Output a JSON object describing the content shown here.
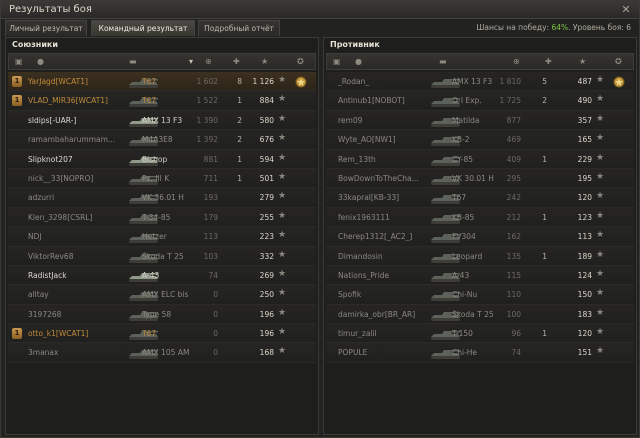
{
  "window": {
    "title": "Результаты боя",
    "close_icon": "close-icon"
  },
  "tabs": [
    {
      "label": "Личный результат",
      "active": false
    },
    {
      "label": "Командный результат",
      "active": true
    },
    {
      "label": "Подробный отчёт",
      "active": false
    }
  ],
  "summary": {
    "win_chance_label": "Шансы на победу:",
    "win_chance_value": "64%",
    "battle_level_label": "Уровень боя:",
    "battle_level_value": "6"
  },
  "allies": {
    "title": "Союзники",
    "rows": [
      {
        "player": "YarJagd[WCAT1]",
        "tank": "T67",
        "damage": "1 602",
        "kills": "8",
        "xp": "1 126",
        "platoon": "1",
        "self": true,
        "alive": false,
        "medal": true
      },
      {
        "player": "VLAD_MIR36[WCAT1]",
        "tank": "T67",
        "damage": "1 522",
        "kills": "1",
        "xp": "884",
        "platoon": "1",
        "self": false,
        "alive": false,
        "medal": false
      },
      {
        "player": "sldips[-UAR-]",
        "tank": "AMX 13 F3",
        "damage": "1 390",
        "kills": "2",
        "xp": "580",
        "platoon": "",
        "self": false,
        "alive": true,
        "medal": false
      },
      {
        "player": "ramambaharummam...",
        "tank": "M4A3E8",
        "damage": "1 392",
        "kills": "2",
        "xp": "676",
        "platoon": "",
        "self": false,
        "alive": false,
        "medal": false
      },
      {
        "player": "Slipknot207",
        "tank": "Bishop",
        "damage": "881",
        "kills": "1",
        "xp": "594",
        "platoon": "",
        "self": false,
        "alive": true,
        "medal": false
      },
      {
        "player": "nick__33[NOPRO]",
        "tank": "Pz. III K",
        "damage": "711",
        "kills": "1",
        "xp": "501",
        "platoon": "",
        "self": false,
        "alive": false,
        "medal": false
      },
      {
        "player": "adzurri",
        "tank": "VK 36.01 H",
        "damage": "193",
        "kills": "",
        "xp": "279",
        "platoon": "",
        "self": false,
        "alive": false,
        "medal": false
      },
      {
        "player": "Klen_3298[CSRL]",
        "tank": "T-34-85",
        "damage": "179",
        "kills": "",
        "xp": "255",
        "platoon": "",
        "self": false,
        "alive": false,
        "medal": false
      },
      {
        "player": "NDJ",
        "tank": "Hetzer",
        "damage": "113",
        "kills": "",
        "xp": "223",
        "platoon": "",
        "self": false,
        "alive": false,
        "medal": false
      },
      {
        "player": "ViktorRev68",
        "tank": "Škoda T 25",
        "damage": "103",
        "kills": "",
        "xp": "332",
        "platoon": "",
        "self": false,
        "alive": false,
        "medal": false
      },
      {
        "player": "RadistJack",
        "tank": "A-43",
        "damage": "74",
        "kills": "",
        "xp": "269",
        "platoon": "",
        "self": false,
        "alive": true,
        "medal": false
      },
      {
        "player": "alltay",
        "tank": "AMX ELC bis",
        "damage": "0",
        "kills": "",
        "xp": "250",
        "platoon": "",
        "self": false,
        "alive": false,
        "medal": false
      },
      {
        "player": "3197268",
        "tank": "Type 58",
        "damage": "0",
        "kills": "",
        "xp": "196",
        "platoon": "",
        "self": false,
        "alive": false,
        "medal": false
      },
      {
        "player": "otto_k1[WCAT1]",
        "tank": "T67",
        "damage": "0",
        "kills": "",
        "xp": "196",
        "platoon": "1",
        "self": false,
        "alive": false,
        "medal": false
      },
      {
        "player": "3manax",
        "tank": "AMX 105 AM",
        "damage": "0",
        "kills": "",
        "xp": "168",
        "platoon": "",
        "self": false,
        "alive": false,
        "medal": false
      }
    ]
  },
  "enemies": {
    "title": "Противник",
    "rows": [
      {
        "player": "_Rodan_",
        "tank": "AMX 13 F3",
        "damage": "1 810",
        "kills": "5",
        "xp": "487",
        "medal": true
      },
      {
        "player": "Antinub1[NOBOT]",
        "tank": "O-I Exp.",
        "damage": "1 725",
        "kills": "2",
        "xp": "490",
        "medal": false
      },
      {
        "player": "rem09",
        "tank": "Matilda",
        "damage": "877",
        "kills": "",
        "xp": "357",
        "medal": false
      },
      {
        "player": "Wyte_AO[NW1]",
        "tank": "KB-2",
        "damage": "469",
        "kills": "",
        "xp": "165",
        "medal": false
      },
      {
        "player": "Rem_13th",
        "tank": "CY-85",
        "damage": "409",
        "kills": "1",
        "xp": "229",
        "medal": false
      },
      {
        "player": "BowDownToTheCha...",
        "tank": "VK 30.01 H",
        "damage": "295",
        "kills": "",
        "xp": "195",
        "medal": false
      },
      {
        "player": "33kapral[KB-33]",
        "tank": "T67",
        "damage": "242",
        "kills": "",
        "xp": "120",
        "medal": false
      },
      {
        "player": "fenix1963111",
        "tank": "KB-85",
        "damage": "212",
        "kills": "1",
        "xp": "123",
        "medal": false
      },
      {
        "player": "Cherep1312[_AC2_]",
        "tank": "FV304",
        "damage": "162",
        "kills": "",
        "xp": "113",
        "medal": false
      },
      {
        "player": "Dimandosin",
        "tank": "Leopard",
        "damage": "135",
        "kills": "1",
        "xp": "189",
        "medal": false
      },
      {
        "player": "Nations_Pride",
        "tank": "A-43",
        "damage": "115",
        "kills": "",
        "xp": "124",
        "medal": false
      },
      {
        "player": "Spofik",
        "tank": "Chi-Nu",
        "damage": "110",
        "kills": "",
        "xp": "150",
        "medal": false
      },
      {
        "player": "damirka_obr[BR_AR]",
        "tank": "Škoda T 25",
        "damage": "100",
        "kills": "",
        "xp": "183",
        "medal": false
      },
      {
        "player": "timur_zalil",
        "tank": "T-150",
        "damage": "96",
        "kills": "1",
        "xp": "120",
        "medal": false
      },
      {
        "player": "POPULE",
        "tank": "Chi-He",
        "damage": "74",
        "kills": "",
        "xp": "151",
        "medal": false
      }
    ]
  }
}
